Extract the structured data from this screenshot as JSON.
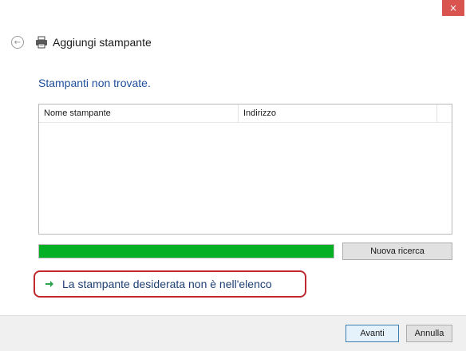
{
  "window": {
    "title": "Aggiungi stampante",
    "close_label": "×",
    "back_label": "←"
  },
  "main": {
    "heading": "Stampanti non trovate.",
    "list": {
      "columns": [
        "Nome stampante",
        "Indirizzo"
      ],
      "rows": []
    },
    "progress": {
      "percent": 100,
      "color": "#06b025"
    },
    "new_search_label": "Nuova ricerca",
    "not_listed_link": "La stampante desiderata non è nell'elenco"
  },
  "footer": {
    "next_label": "Avanti",
    "cancel_label": "Annulla"
  },
  "colors": {
    "accent_heading": "#1e4f9c",
    "highlight_border": "#c0282d",
    "close_button": "#d9534f",
    "arrow": "#2da44e"
  },
  "icons": [
    "back-arrow-icon",
    "printer-icon",
    "green-arrow-icon",
    "close-icon"
  ]
}
